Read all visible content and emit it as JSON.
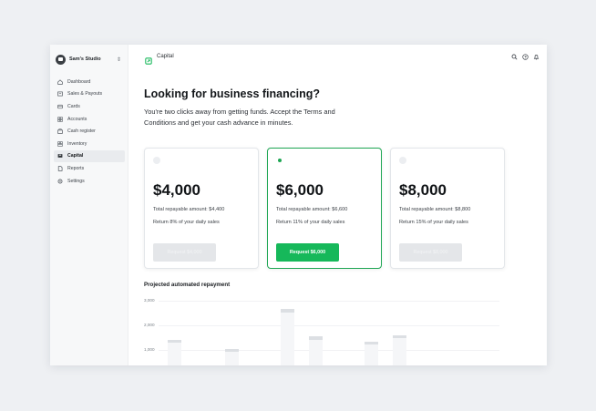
{
  "sidebar": {
    "org_name": "Sam's Studio",
    "items": [
      {
        "label": "Dashboard",
        "icon": "home-icon"
      },
      {
        "label": "Sales & Payouts",
        "icon": "receipt-icon"
      },
      {
        "label": "Cards",
        "icon": "card-icon"
      },
      {
        "label": "Accounts",
        "icon": "grid-icon"
      },
      {
        "label": "Cash register",
        "icon": "register-icon"
      },
      {
        "label": "Inventory",
        "icon": "inventory-icon"
      },
      {
        "label": "Capital",
        "icon": "capital-icon",
        "active": true
      },
      {
        "label": "Reports",
        "icon": "report-icon"
      },
      {
        "label": "Settings",
        "icon": "gear-icon"
      }
    ]
  },
  "header": {
    "crumb": "Capital"
  },
  "main": {
    "heading": "Looking for business financing?",
    "subtext": "You're two clicks away from getting funds. Accept the Terms and Conditions and get your cash advance in minutes."
  },
  "offers": [
    {
      "amount": "$4,000",
      "repay": "Total repayable amount: $4,400",
      "return": "Return 8% of your daily sales",
      "button": "Request $4,000",
      "selected": false
    },
    {
      "amount": "$6,000",
      "repay": "Total repayable amount: $6,600",
      "return": "Return 11% of your daily sales",
      "button": "Request $6,000",
      "selected": true
    },
    {
      "amount": "$8,000",
      "repay": "Total repayable amount: $8,800",
      "return": "Return 15% of your daily sales",
      "button": "Request $8,000",
      "selected": false
    }
  ],
  "projection": {
    "title": "Projected automated repayment",
    "y_ticks": [
      "3,000",
      "2,000",
      "1,000"
    ]
  },
  "colors": {
    "accent": "#16b85a",
    "accent_border": "#1ea653",
    "disabled": "#e4e6e9"
  }
}
